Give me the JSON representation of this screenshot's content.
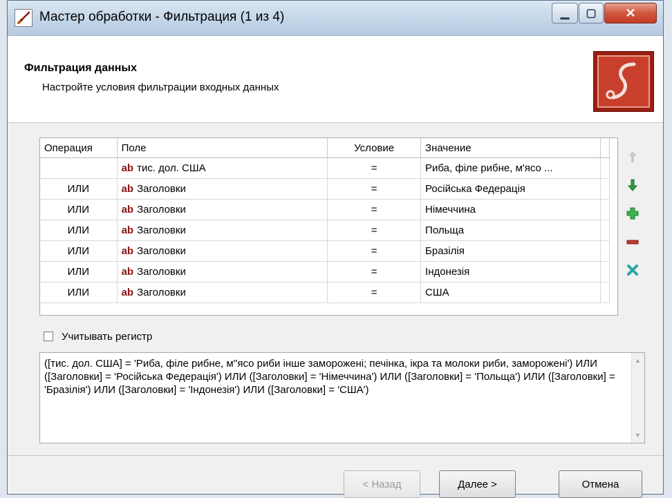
{
  "window": {
    "title": "Мастер обработки - Фильтрация (1 из 4)"
  },
  "header": {
    "title": "Фильтрация данных",
    "subtitle": "Настройте условия фильтрации входных данных"
  },
  "grid": {
    "columns": {
      "operation": "Операция",
      "field": "Поле",
      "condition": "Условие",
      "value": "Значение"
    },
    "type_icon_label": "ab",
    "rows": [
      {
        "operation": "",
        "field": "тис. дол. США",
        "condition": "=",
        "value": "Риба, філе рибне, м'ясо ..."
      },
      {
        "operation": "ИЛИ",
        "field": "Заголовки",
        "condition": "=",
        "value": "Російська Федерація"
      },
      {
        "operation": "ИЛИ",
        "field": "Заголовки",
        "condition": "=",
        "value": "Німеччина"
      },
      {
        "operation": "ИЛИ",
        "field": "Заголовки",
        "condition": "=",
        "value": "Польща"
      },
      {
        "operation": "ИЛИ",
        "field": "Заголовки",
        "condition": "=",
        "value": "Бразілія"
      },
      {
        "operation": "ИЛИ",
        "field": "Заголовки",
        "condition": "=",
        "value": "Індонезія"
      },
      {
        "operation": "ИЛИ",
        "field": "Заголовки",
        "condition": "=",
        "value": "США"
      }
    ]
  },
  "side_tools": [
    "arrow-up-icon",
    "arrow-down-icon",
    "plus-icon",
    "minus-icon",
    "clear-icon"
  ],
  "case_sensitive": {
    "label": "Учитывать регистр",
    "checked": false
  },
  "expression": "([тис. дол. США] = 'Риба, філе рибне, м''ясо риби інше заморожені;  печінка, ікра та молоки риби, заморожені') ИЛИ ([Заголовки] = 'Російська Федерація') ИЛИ ([Заголовки] = 'Німеччина') ИЛИ ([Заголовки] = 'Польща') ИЛИ ([Заголовки] = 'Бразілія') ИЛИ ([Заголовки] = 'Індонезія') ИЛИ ([Заголовки] = 'США')",
  "buttons": {
    "back": "< Назад",
    "next": "Далее >",
    "cancel": "Отмена"
  },
  "colors": {
    "accent_red": "#9a1f12",
    "type_icon": "#8b1313",
    "arrow_green": "#2e9e3e",
    "minus_red": "#c0392b",
    "clear_teal": "#2aa6a6"
  }
}
